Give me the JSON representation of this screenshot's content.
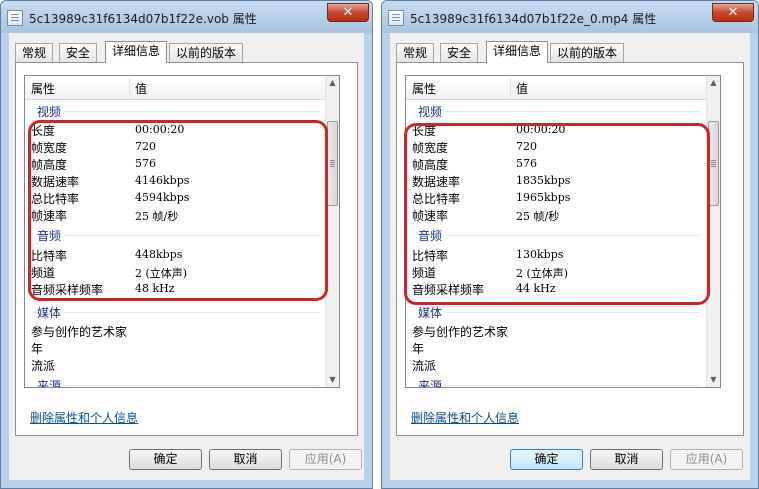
{
  "tab_labels": [
    "常规",
    "安全",
    "详细信息",
    "以前的版本"
  ],
  "header": {
    "property": "属性",
    "value": "值"
  },
  "buttons": {
    "ok": "确定",
    "cancel": "取消",
    "apply": "应用(A)"
  },
  "close_glyph": "✕",
  "remove_link": "删除属性和个人信息",
  "colors": {
    "highlight": "#d2232a",
    "group_text": "#1e3287",
    "link": "#0d4f94",
    "title_bar": "#b9d1ea"
  },
  "dialogs": [
    {
      "title": "5c13989c31f6134d07b1f22e.vob 属性",
      "groups": {
        "video": "视频",
        "audio": "音频",
        "media": "媒体",
        "source": "来源"
      },
      "video": [
        {
          "key": "长度",
          "value": "00:00:20"
        },
        {
          "key": "帧宽度",
          "value": "720"
        },
        {
          "key": "帧高度",
          "value": "576"
        },
        {
          "key": "数据速率",
          "value": "4146kbps"
        },
        {
          "key": "总比特率",
          "value": "4594kbps"
        },
        {
          "key": "帧速率",
          "value": "25 帧/秒"
        }
      ],
      "audio": [
        {
          "key": "比特率",
          "value": "448kbps"
        },
        {
          "key": "频道",
          "value": "2 (立体声)"
        },
        {
          "key": "音频采样频率",
          "value": "48 kHz"
        }
      ],
      "media": [
        {
          "key": "参与创作的艺术家",
          "value": ""
        },
        {
          "key": "年",
          "value": ""
        },
        {
          "key": "流派",
          "value": ""
        }
      ]
    },
    {
      "title": "5c13989c31f6134d07b1f22e_0.mp4 属性",
      "groups": {
        "video": "视频",
        "audio": "音频",
        "media": "媒体",
        "source": "来源"
      },
      "video": [
        {
          "key": "长度",
          "value": "00:00:20"
        },
        {
          "key": "帧宽度",
          "value": "720"
        },
        {
          "key": "帧高度",
          "value": "576"
        },
        {
          "key": "数据速率",
          "value": "1835kbps"
        },
        {
          "key": "总比特率",
          "value": "1965kbps"
        },
        {
          "key": "帧速率",
          "value": "25 帧/秒"
        }
      ],
      "audio": [
        {
          "key": "比特率",
          "value": "130kbps"
        },
        {
          "key": "频道",
          "value": "2 (立体声)"
        },
        {
          "key": "音频采样频率",
          "value": "44 kHz"
        }
      ],
      "media": [
        {
          "key": "参与创作的艺术家",
          "value": ""
        },
        {
          "key": "年",
          "value": ""
        },
        {
          "key": "流派",
          "value": ""
        }
      ]
    }
  ]
}
